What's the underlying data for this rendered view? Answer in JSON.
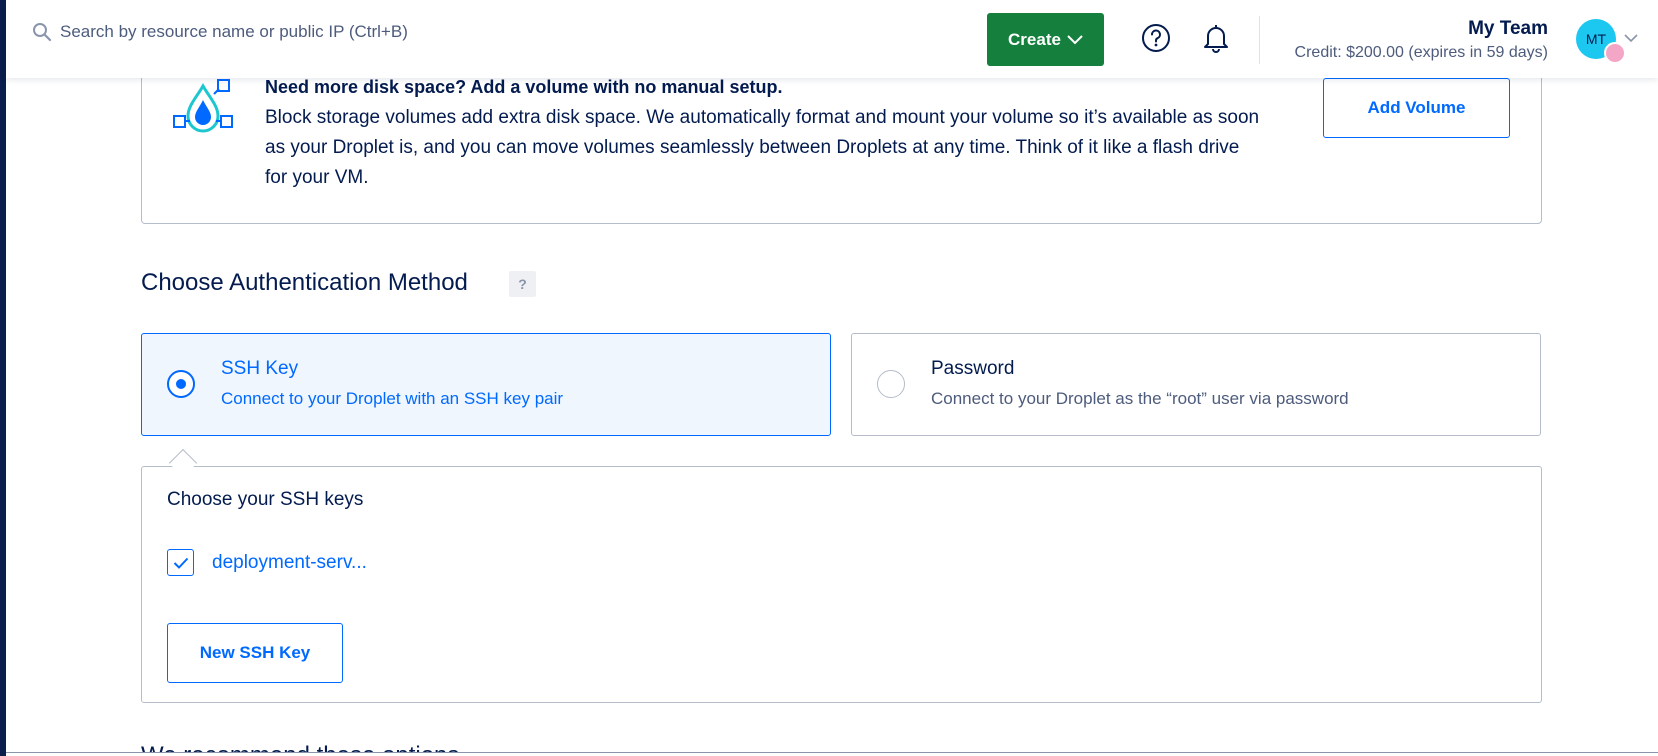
{
  "header": {
    "search_placeholder": "Search by resource name or public IP (Ctrl+B)",
    "create_label": "Create",
    "team_name": "My Team",
    "credit_text": "Credit: $200.00 (expires in 59 days)",
    "avatar_initials": "MT"
  },
  "promo": {
    "title": "Need more disk space? Add a volume with no manual setup.",
    "body": "Block storage volumes add extra disk space. We automatically format and mount your volume so it’s available as soon as your Droplet is, and you can move volumes seamlessly between Droplets at any time. Think of it like a flash drive for your VM.",
    "button_label": "Add Volume"
  },
  "auth": {
    "title": "Choose Authentication Method",
    "help_label": "?",
    "options": [
      {
        "title": "SSH Key",
        "description": "Connect to your Droplet with an SSH key pair",
        "selected": true
      },
      {
        "title": "Password",
        "description": "Connect to your Droplet as the “root” user via password",
        "selected": false
      }
    ]
  },
  "ssh_keys": {
    "title": "Choose your SSH keys",
    "keys": [
      {
        "label": "deployment-serv...",
        "checked": true
      }
    ],
    "new_key_label": "New SSH Key"
  },
  "next_section": {
    "title": "We recommend these options"
  },
  "colors": {
    "brand_blue": "#0069ff",
    "create_green": "#15803d",
    "text_dark": "#031b4e",
    "selected_bg": "#eff6fe"
  }
}
